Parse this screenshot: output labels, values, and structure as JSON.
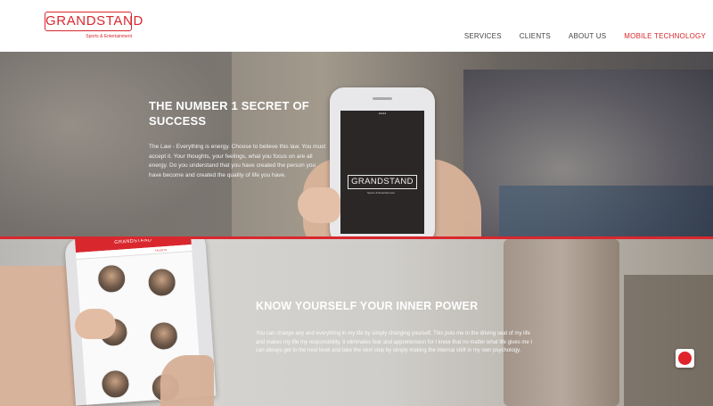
{
  "brand": {
    "logo_text": "GRANDSTAND",
    "tagline": "Sports & Entertainment",
    "color": "#d9272e"
  },
  "nav": {
    "items": [
      {
        "label": "SERVICES"
      },
      {
        "label": "CLIENTS"
      },
      {
        "label": "ABOUT US"
      },
      {
        "label": "MOBILE TECHNOLOGY",
        "active": true
      }
    ]
  },
  "hero1": {
    "title": "THE NUMBER 1 SECRET OF SUCCESS",
    "text": "The Law - Everything is energy. Choose to believe this law. You must accept it. Your thoughts, your feelings, what you focus on are all energy. Do you understand that you have created the person you have become and created the quality of life you have.",
    "phone_logo": "GRANDSTAND",
    "phone_tagline": "Sports & Entertainment"
  },
  "hero2": {
    "title": "KNOW YOURSELF YOUR INNER POWER",
    "text": "You can change any and everything in my life by simply changing yourself. This puts me in the driving seat of my life and makes my life my responsibility. It eliminates fear and apprehension for I know that no matter what life gives me I can always get to the next level and take the next step by simply making the internal shift in my own psychology.",
    "phone_app_title": "GRANDSTAND",
    "phone_tab": "TALENTS"
  },
  "chat": {
    "icon": "chat-bubble-icon"
  }
}
